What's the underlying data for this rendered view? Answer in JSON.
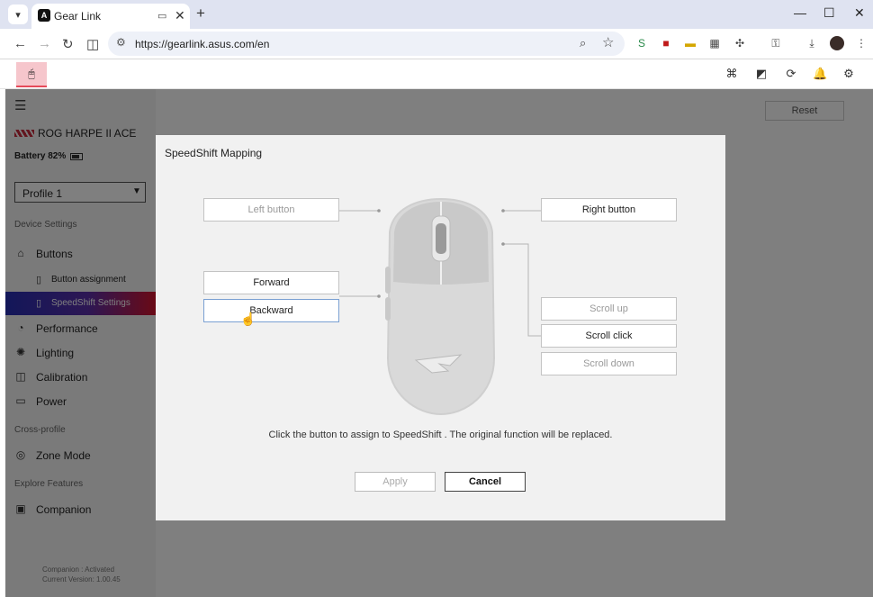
{
  "browser": {
    "tab_title": "Gear Link",
    "tab_favicon": "ASUS",
    "url": "https://gearlink.asus.com/en"
  },
  "app": {
    "reset_label": "Reset"
  },
  "sidebar": {
    "device_name": "ROG HARPE II ACE",
    "battery_label": "Battery 82%",
    "battery_level": 0.82,
    "profile_selected": "Profile 1",
    "sections": {
      "device_settings": "Device Settings",
      "cross_profile": "Cross-profile",
      "explore_features": "Explore Features"
    },
    "items": {
      "buttons": "Buttons",
      "button_assignment": "Button assignment",
      "speedshift_settings": "SpeedShift Settings",
      "performance": "Performance",
      "lighting": "Lighting",
      "calibration": "Calibration",
      "power": "Power",
      "zone_mode": "Zone Mode",
      "companion": "Companion"
    },
    "footer": {
      "status": "Companion : Activated",
      "version": "Current Version: 1.00.45"
    }
  },
  "modal": {
    "title": "SpeedShift Mapping",
    "buttons": {
      "left": "Left button",
      "right": "Right button",
      "forward": "Forward",
      "backward": "Backward",
      "scroll_up": "Scroll up",
      "scroll_click": "Scroll click",
      "scroll_down": "Scroll down"
    },
    "instruction": "Click the button to assign to SpeedShift . The original function will be replaced.",
    "apply_label": "Apply",
    "cancel_label": "Cancel"
  }
}
